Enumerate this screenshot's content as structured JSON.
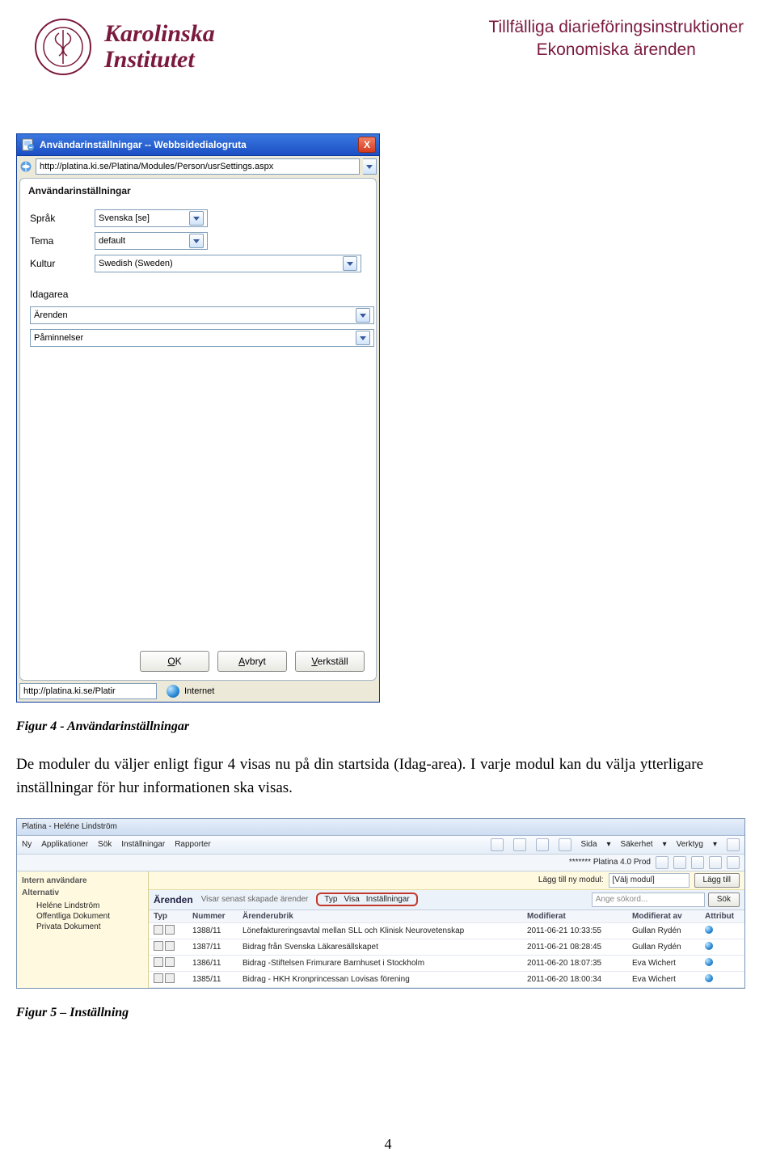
{
  "header": {
    "brand_line1": "Karolinska",
    "brand_line2": "Institutet",
    "right_line1": "Tillfälliga diarieföringsinstruktioner",
    "right_line2": "Ekonomiska ärenden"
  },
  "dialog": {
    "title": "Användarinställningar -- Webbsidedialogruta",
    "close_x": "X",
    "url": "http://platina.ki.se/Platina/Modules/Person/usrSettings.aspx",
    "panel_title": "Användarinställningar",
    "fields": {
      "language_label": "Språk",
      "language_value": "Svenska [se]",
      "theme_label": "Tema",
      "theme_value": "default",
      "culture_label": "Kultur",
      "culture_value": "Swedish (Sweden)"
    },
    "idag_label": "Idagarea",
    "idag_list1": "Ärenden",
    "idag_list2": "Påminnelser",
    "buttons": {
      "ok": "OK",
      "cancel": "Avbryt",
      "apply": "Verkställ"
    },
    "status_url": "http://platina.ki.se/Platir",
    "zone": "Internet"
  },
  "captions": {
    "fig4": "Figur 4 - Användarinställningar",
    "fig5": "Figur 5 – Inställning"
  },
  "paragraph": "De moduler du väljer enligt figur 4 visas nu på din startsida (Idag-area). I varje modul kan du välja ytterligare inställningar för hur informationen ska visas.",
  "fig5": {
    "window_title": "Platina - Heléne Lindström",
    "menu": [
      "Ny",
      "Applikationer",
      "Sök",
      "Inställningar",
      "Rapporter"
    ],
    "right_menu": [
      "Sida",
      "Säkerhet",
      "Verktyg"
    ],
    "prod_label": "******* Platina 4.0 Prod",
    "side_section1": "Intern användare",
    "side_section2": "Alternativ",
    "tree": [
      "Heléne Lindström",
      "Offentliga Dokument",
      "Privata Dokument"
    ],
    "mod_add_label": "Lägg till ny modul:",
    "mod_add_value": "[Välj modul]",
    "mod_add_button": "Lägg till",
    "main_heading": "Ärenden",
    "main_sub": "Visar senast skapade ärender",
    "tabs": [
      "Typ",
      "Visa",
      "Inställningar"
    ],
    "search_placeholder": "Ange sökord...",
    "search_button": "Sök",
    "columns": [
      "Typ",
      "Nummer",
      "Ärenderubrik",
      "Modifierat",
      "Modifierat av",
      "Attribut"
    ],
    "rows": [
      {
        "nummer": "1388/11",
        "rubrik": "Lönefaktureringsavtal mellan SLL och Klinisk Neurovetenskap",
        "mod": "2011-06-21 10:33:55",
        "av": "Gullan Rydén"
      },
      {
        "nummer": "1387/11",
        "rubrik": "Bidrag från Svenska Läkaresällskapet",
        "mod": "2011-06-21 08:28:45",
        "av": "Gullan Rydén"
      },
      {
        "nummer": "1386/11",
        "rubrik": "Bidrag -Stiftelsen Frimurare Barnhuset i Stockholm",
        "mod": "2011-06-20 18:07:35",
        "av": "Eva Wichert"
      },
      {
        "nummer": "1385/11",
        "rubrik": "Bidrag - HKH Kronprincessan Lovisas förening",
        "mod": "2011-06-20 18:00:34",
        "av": "Eva Wichert"
      }
    ]
  },
  "page_number": "4"
}
